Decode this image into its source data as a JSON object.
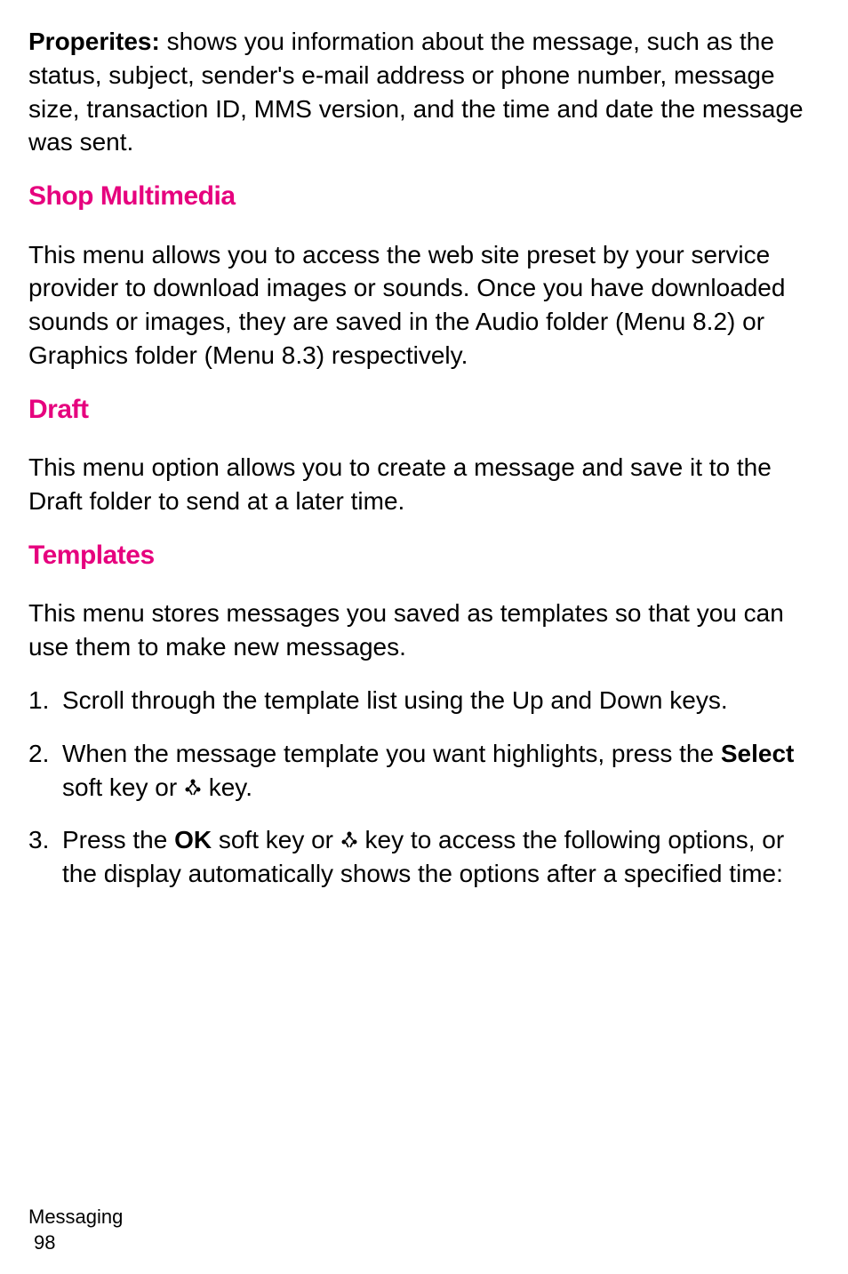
{
  "para1": {
    "bold": "Properites:",
    "text": " shows you information about the message, such as the status, subject, sender's e-mail address or phone number, message size, transaction ID, MMS version, and the time and date the message was sent."
  },
  "section1": {
    "heading": "Shop Multimedia",
    "body": "This menu allows you to access the web site preset by your service provider to download images or sounds. Once you have downloaded sounds or images, they are saved in the Audio folder (Menu 8.2) or Graphics folder (Menu 8.3) respectively."
  },
  "section2": {
    "heading": "Draft",
    "body": "This menu option allows you to create a message and save it to the Draft folder to send at a later time."
  },
  "section3": {
    "heading": "Templates",
    "intro": "This menu stores messages you saved as templates so that you can use them to make new messages.",
    "items": [
      {
        "num": "1.",
        "text": "Scroll through the template list using the Up and Down keys."
      },
      {
        "num": "2.",
        "textStart": "When the message template you want highlights, press the ",
        "bold1": "Select",
        "textMid": " soft key or ",
        "textEnd": " key."
      },
      {
        "num": "3.",
        "textStart": "Press the ",
        "bold1": "OK",
        "textMid": " soft key or ",
        "textEnd": " key to access the following options, or the display automatically shows the options after a specified time:"
      }
    ]
  },
  "footer": {
    "chapter": "Messaging",
    "page": "98"
  }
}
